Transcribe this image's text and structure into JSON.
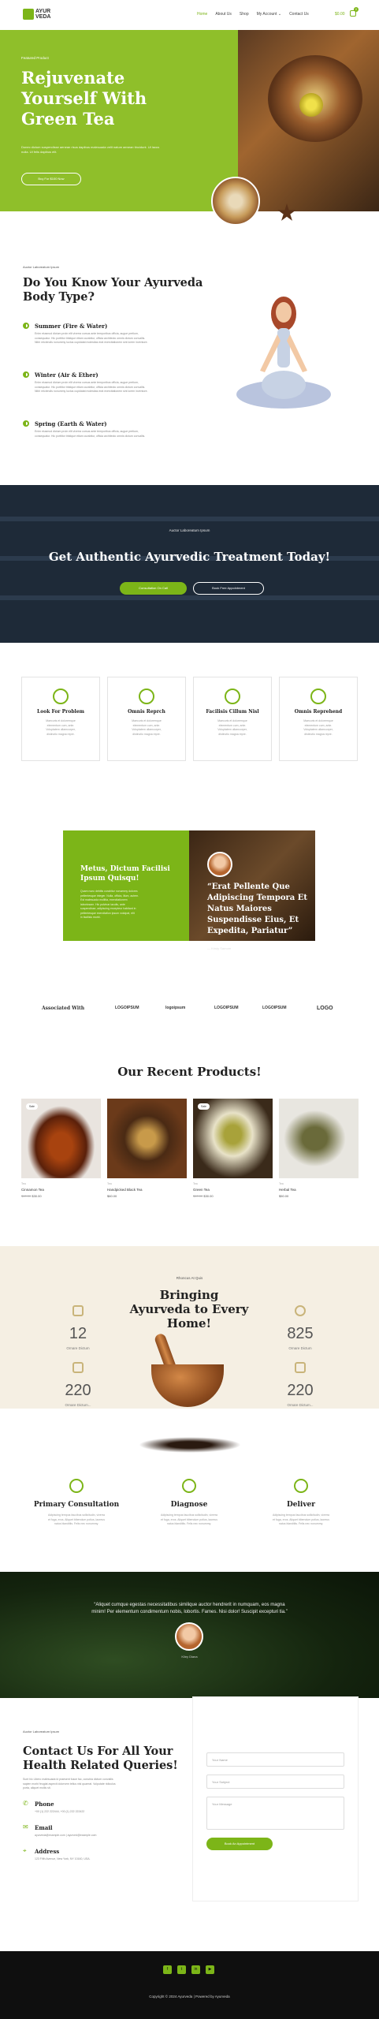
{
  "header": {
    "logo_top": "AYUR",
    "logo_bottom": "VEDA",
    "nav": [
      "Home",
      "About Us",
      "Shop",
      "My Account",
      "Contact Us"
    ],
    "cart_price": "$0.00",
    "cart_count": "0"
  },
  "hero": {
    "tag": "Featured Product",
    "title_1": "Rejuvenate",
    "title_2": "Yourself With",
    "title_3": "Green Tea",
    "desc": "Donec dictum suspendisse aenean risus dapibus malesuada velit natum aenean tincidunt. Ut lacus nulla. Ut felis dapibus elit.",
    "button": "Buy For $100 Now"
  },
  "dosha": {
    "label": "Auctor Laboreatum Ipsum",
    "title_1": "Do You Know Your Ayurveda",
    "title_2": "Body Type?",
    "items": [
      {
        "title": "Summer (Fire & Water)",
        "desc_1": "Enim eiusmod dictum proin elit viverra cursus ante temporibus officia, augue pretium,",
        "desc_2": "consequatur. Hic porttitor tristique etiam curabitur, officia architecto omnis dictum convallis.",
        "desc_3": "Nibh reiciendis nonummy luctus cupidatat molestias erat exercitationem sint lorem inventore."
      },
      {
        "title": "Winter (Air & Ether)",
        "desc_1": "Enim eiusmod dictum proin elit viverra cursus ante temporibus officia, augue pretium,",
        "desc_2": "consequatur. Hic porttitor tristique etiam curabitur, officia architecto omnis dictum convallis.",
        "desc_3": "Nibh reiciendis nonummy luctus cupidatat molestias erat exercitationem sint lorem inventore."
      },
      {
        "title": "Spring (Earth & Water)",
        "desc_1": "Enim eiusmod dictum proin elit viverra cursus ante temporibus officia, augue pretium,",
        "desc_2": "consequatur. Hic porttitor tristique etiam curabitur, officia architecto omnis dictum convallis."
      }
    ]
  },
  "treatment": {
    "label": "Auctor Laboreatum Ipsum",
    "title": "Get Authentic Ayurvedic Treatment Today!",
    "button_1": "Consultation On Call",
    "button_2": "Book Free Appointment"
  },
  "features": [
    {
      "title": "Look For Problem",
      "d1": "Maecuris et doloremque",
      "d2": "elementum cum, ante.",
      "d3": "Voluptatem ullamcorper,",
      "d4": "distinctio magna repre."
    },
    {
      "title": "Omnis Reprch",
      "d1": "Maecuris et doloremque",
      "d2": "elementum cum, ante.",
      "d3": "Voluptatem ullamcorper,",
      "d4": "distinctio magna repre."
    },
    {
      "title": "Facilisis Cillum Nisl",
      "d1": "Maecuris et doloremque",
      "d2": "elementum cum, ante.",
      "d3": "Voluptatem ullamcorper,",
      "d4": "distinctio magna repre."
    },
    {
      "title": "Omnis Reprehend",
      "d1": "Maecuris et doloremque",
      "d2": "elementum cum, ante.",
      "d3": "Voluptatem ullamcorper,",
      "d4": "distinctio magna repre."
    }
  ],
  "split": {
    "title_1": "Metus, Dictum Facilisi",
    "title_2": "Ipsum Quisqu!",
    "desc_1": "Quam nunc debitis curabitur nonummy dolores",
    "desc_2": "pellentesque integer. Nulla, officia, illum, autem.",
    "desc_3": "Est malesuada mollitia, exercitationem",
    "desc_4": "laboriosam. Hic pulvinar iaculis, ante",
    "desc_5": "suspendisse, adipiscing excepteur habitant in",
    "desc_6": "pellentesque exercitation ipsum volutpat, elit",
    "desc_7": "in facilisis morbi.",
    "quote_1": "“Erat Pellente Que",
    "quote_2": "Adipiscing Tempora Et",
    "quote_3": "Natus Maiores",
    "quote_4": "Suspendisse Eius, Et",
    "quote_5": "Expedita, Pariatur”",
    "author": "— Kristy Samore"
  },
  "logos": {
    "label": "Associated With",
    "items": [
      "LOGOIPSUM",
      "logoipsum",
      "LOGOIPSUM",
      "LOGOIPSUM",
      "LOGO"
    ]
  },
  "products": {
    "title": "Our Recent Products!",
    "items": [
      {
        "sale": "Sale",
        "cat": "Tea",
        "name": "Cinnamon Tea",
        "old": "$40.00",
        "price": "$30.00"
      },
      {
        "sale": "",
        "cat": "Tea",
        "name": "Handpicked Black Tea",
        "old": "",
        "price": "$60.00"
      },
      {
        "sale": "Sale",
        "cat": "Tea",
        "name": "Green Tea",
        "old": "$40.00",
        "price": "$30.00"
      },
      {
        "sale": "",
        "cat": "Tea",
        "name": "Herbal Tea",
        "old": "",
        "price": "$50.00"
      }
    ]
  },
  "stats": {
    "label": "Rhoncus At Quis",
    "title_1": "Bringing",
    "title_2": "Ayurveda to Every",
    "title_3": "Home!",
    "items": [
      {
        "num": "12",
        "label": "Ornare Dictum"
      },
      {
        "num": "220",
        "label": "Ornare Dictum..."
      },
      {
        "num": "825",
        "label": "Ornare Dictum"
      },
      {
        "num": "220",
        "label": "Ornare Dictum..."
      }
    ]
  },
  "services": [
    {
      "title": "Primary Consultation",
      "d1": "Adipiscing tempus faucibus sollicitudin, viverra",
      "d2": "et fuga, eros. Aliquet bibendum potius, laoreus",
      "d3": "natus blanditiis. Felis nec nonummy."
    },
    {
      "title": "Diagnose",
      "d1": "Adipiscing tempus faucibus sollicitudin, viverra",
      "d2": "et fuga, eros. Aliquet bibendum potius, laoreus",
      "d3": "natus blanditiis. Felis nec nonummy."
    },
    {
      "title": "Deliver",
      "d1": "Adipiscing tempus faucibus sollicitudin, viverra",
      "d2": "et fuga, eros. Aliquet bibendum potius, laoreus",
      "d3": "natus blanditiis. Felis nec nonummy."
    }
  ],
  "testimonial": {
    "quote_1": "“Aliquet cumque egestas necessitatibus similique auctor hendrerit in numquam, eos magna",
    "quote_2": "minim! Per elementum condimentum nobis, lobortis. Fames. Nisi dolor! Suscipit excepturi tia.”",
    "name": "Kiley Diana"
  },
  "contact": {
    "label": "Auctor Laboreatum Ipsum",
    "title_1": "Contact Us For All Your",
    "title_2": "Health Related Queries!",
    "desc_1": "Sunt hic Libero malesuada id praesent fusce fac, conubia dictum convallis",
    "desc_2": "sapien morbi feugiat aspecti dolorvem tellus nisl quaerat. Vulputate ridiculus",
    "desc_3": "porta, aliquet mollis sit.",
    "phone_label": "Phone",
    "phone": "+00 (1) 222 222444, +00 (1) 222 222422",
    "email_label": "Email",
    "email": "ayurveda@example.com | ayurved@example.com",
    "address_label": "Address",
    "address": "123 Fifth Avenue, New York, NY 10160, USA.",
    "name_ph": "Your Name",
    "subject_ph": "Your Subject",
    "message_ph": "Your Message",
    "submit": "Book An Appointment"
  },
  "footer": {
    "copyright": "Copyright © 2024 Ayurveda | Powered by Ayurveda",
    "social": [
      "f",
      "t",
      "in",
      "▶"
    ]
  },
  "colors": {
    "accent": "#7cb518",
    "dark": "#1e2a38",
    "cream": "#f5efe3"
  }
}
